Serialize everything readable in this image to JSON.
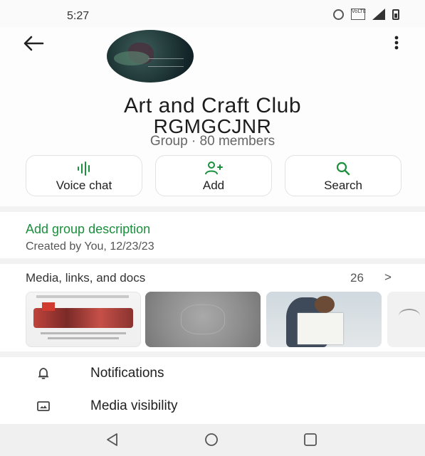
{
  "status_bar": {
    "time": "5:27",
    "volte_label": "VoLTE"
  },
  "header": {
    "group_name_line1": "Art and Craft Club",
    "group_name_line2": "RGMGCJNR",
    "group_meta": "Group · 80 members"
  },
  "actions": [
    {
      "label": "Voice chat",
      "icon": "voice-waveform-icon"
    },
    {
      "label": "Add",
      "icon": "add-person-icon"
    },
    {
      "label": "Search",
      "icon": "search-icon"
    }
  ],
  "description": {
    "add_label": "Add group description",
    "created_text": "Created by You, 12/23/23"
  },
  "media": {
    "title": "Media, links, and docs",
    "count": "26",
    "chevron": ">"
  },
  "menu": [
    {
      "label": "Notifications",
      "icon": "bell-icon"
    },
    {
      "label": "Media visibility",
      "icon": "image-icon"
    }
  ],
  "colors": {
    "accent": "#1a8f3c",
    "text": "#1f1f1f",
    "muted": "#666666"
  }
}
